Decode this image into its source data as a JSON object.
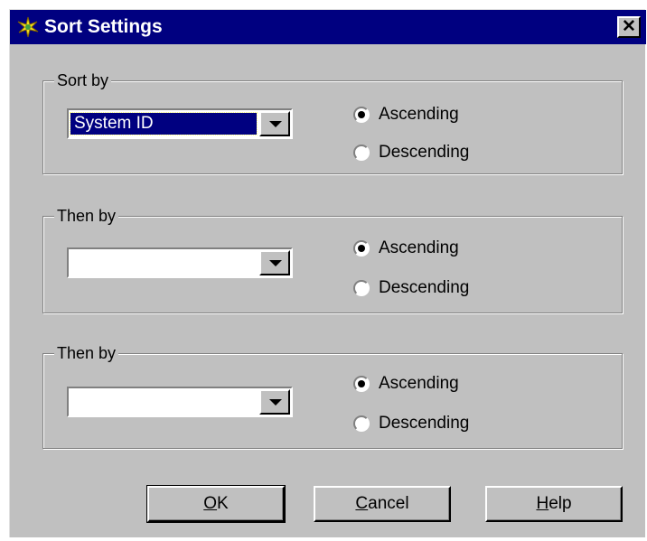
{
  "window": {
    "title": "Sort Settings",
    "close_label": "✕",
    "title_icon": "sparkle-icon",
    "titlebar_color": "#000080",
    "face_color": "#c0c0c0"
  },
  "groups": [
    {
      "legend": "Sort by",
      "combo_value": "System ID",
      "combo_selected": true,
      "ascending_label": "Ascending",
      "descending_label": "Descending",
      "selected_order": "Ascending"
    },
    {
      "legend": "Then by",
      "combo_value": "",
      "combo_selected": false,
      "ascending_label": "Ascending",
      "descending_label": "Descending",
      "selected_order": "Ascending"
    },
    {
      "legend": "Then by",
      "combo_value": "",
      "combo_selected": false,
      "ascending_label": "Ascending",
      "descending_label": "Descending",
      "selected_order": "Ascending"
    }
  ],
  "buttons": {
    "ok": {
      "mnemonic": "O",
      "rest": "K"
    },
    "cancel": {
      "mnemonic": "C",
      "rest": "ancel"
    },
    "help": {
      "mnemonic": "H",
      "rest": "elp"
    }
  }
}
